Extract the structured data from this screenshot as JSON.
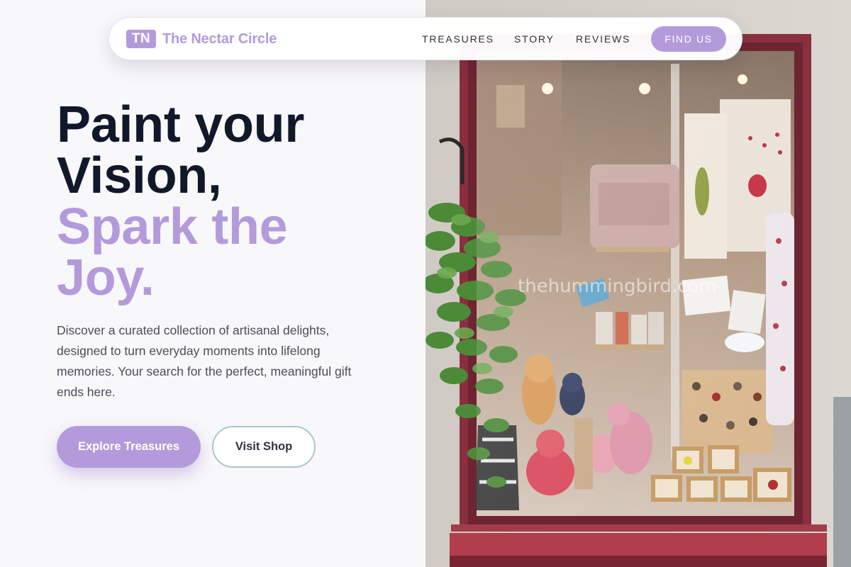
{
  "brand": {
    "badge": "TN",
    "name": "The Nectar Circle"
  },
  "nav": {
    "links": [
      "TREASURES",
      "STORY",
      "REVIEWS"
    ],
    "cta": "FIND US"
  },
  "hero": {
    "title_lines": [
      "Paint your",
      "Vision,"
    ],
    "accent_lines": [
      "Spark the",
      "Joy."
    ],
    "description": "Discover a curated collection of artisanal delights, designed to turn everyday moments into lifelong memories. Your search for the perfect, meaningful gift ends here.",
    "primary_button": "Explore Treasures",
    "secondary_button": "Visit Shop"
  },
  "image": {
    "watermark": "thehummingbird.com"
  },
  "colors": {
    "accent": "#b39bdb",
    "heading": "#11182a",
    "body_text": "#4a4e5a",
    "window_frame": "#8a2f3e",
    "secondary_border": "#a9c6cc"
  }
}
